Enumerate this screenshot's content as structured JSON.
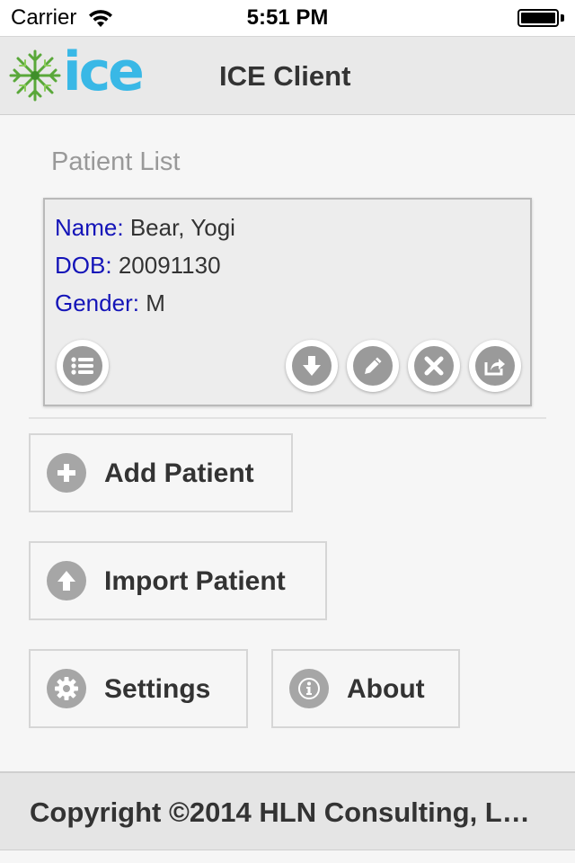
{
  "status_bar": {
    "carrier": "Carrier",
    "time": "5:51 PM",
    "battery_level": 1.0
  },
  "header": {
    "logo_text": "ice",
    "title": "ICE Client",
    "brand_color": "#39b8e6",
    "logo_mark_color": "#5aa83a"
  },
  "patient_list": {
    "title": "Patient List",
    "patients": [
      {
        "name_label": "Name:",
        "name": "Bear, Yogi",
        "dob_label": "DOB:",
        "dob": "20091130",
        "gender_label": "Gender:",
        "gender": "M",
        "actions": [
          {
            "icon": "list-icon"
          },
          {
            "icon": "download-icon"
          },
          {
            "icon": "pencil-icon"
          },
          {
            "icon": "close-icon"
          },
          {
            "icon": "share-icon"
          }
        ]
      }
    ]
  },
  "actions": {
    "add_patient": {
      "label": "Add Patient",
      "icon": "plus-icon"
    },
    "import_patient": {
      "label": "Import Patient",
      "icon": "upload-icon"
    },
    "settings": {
      "label": "Settings",
      "icon": "gear-icon"
    },
    "about": {
      "label": "About",
      "icon": "info-icon"
    }
  },
  "footer": {
    "copyright": "Copyright ©2014 HLN Consulting, L…"
  },
  "colors": {
    "field_label": "#1414b8",
    "icon_gray": "#9a9a9a"
  }
}
